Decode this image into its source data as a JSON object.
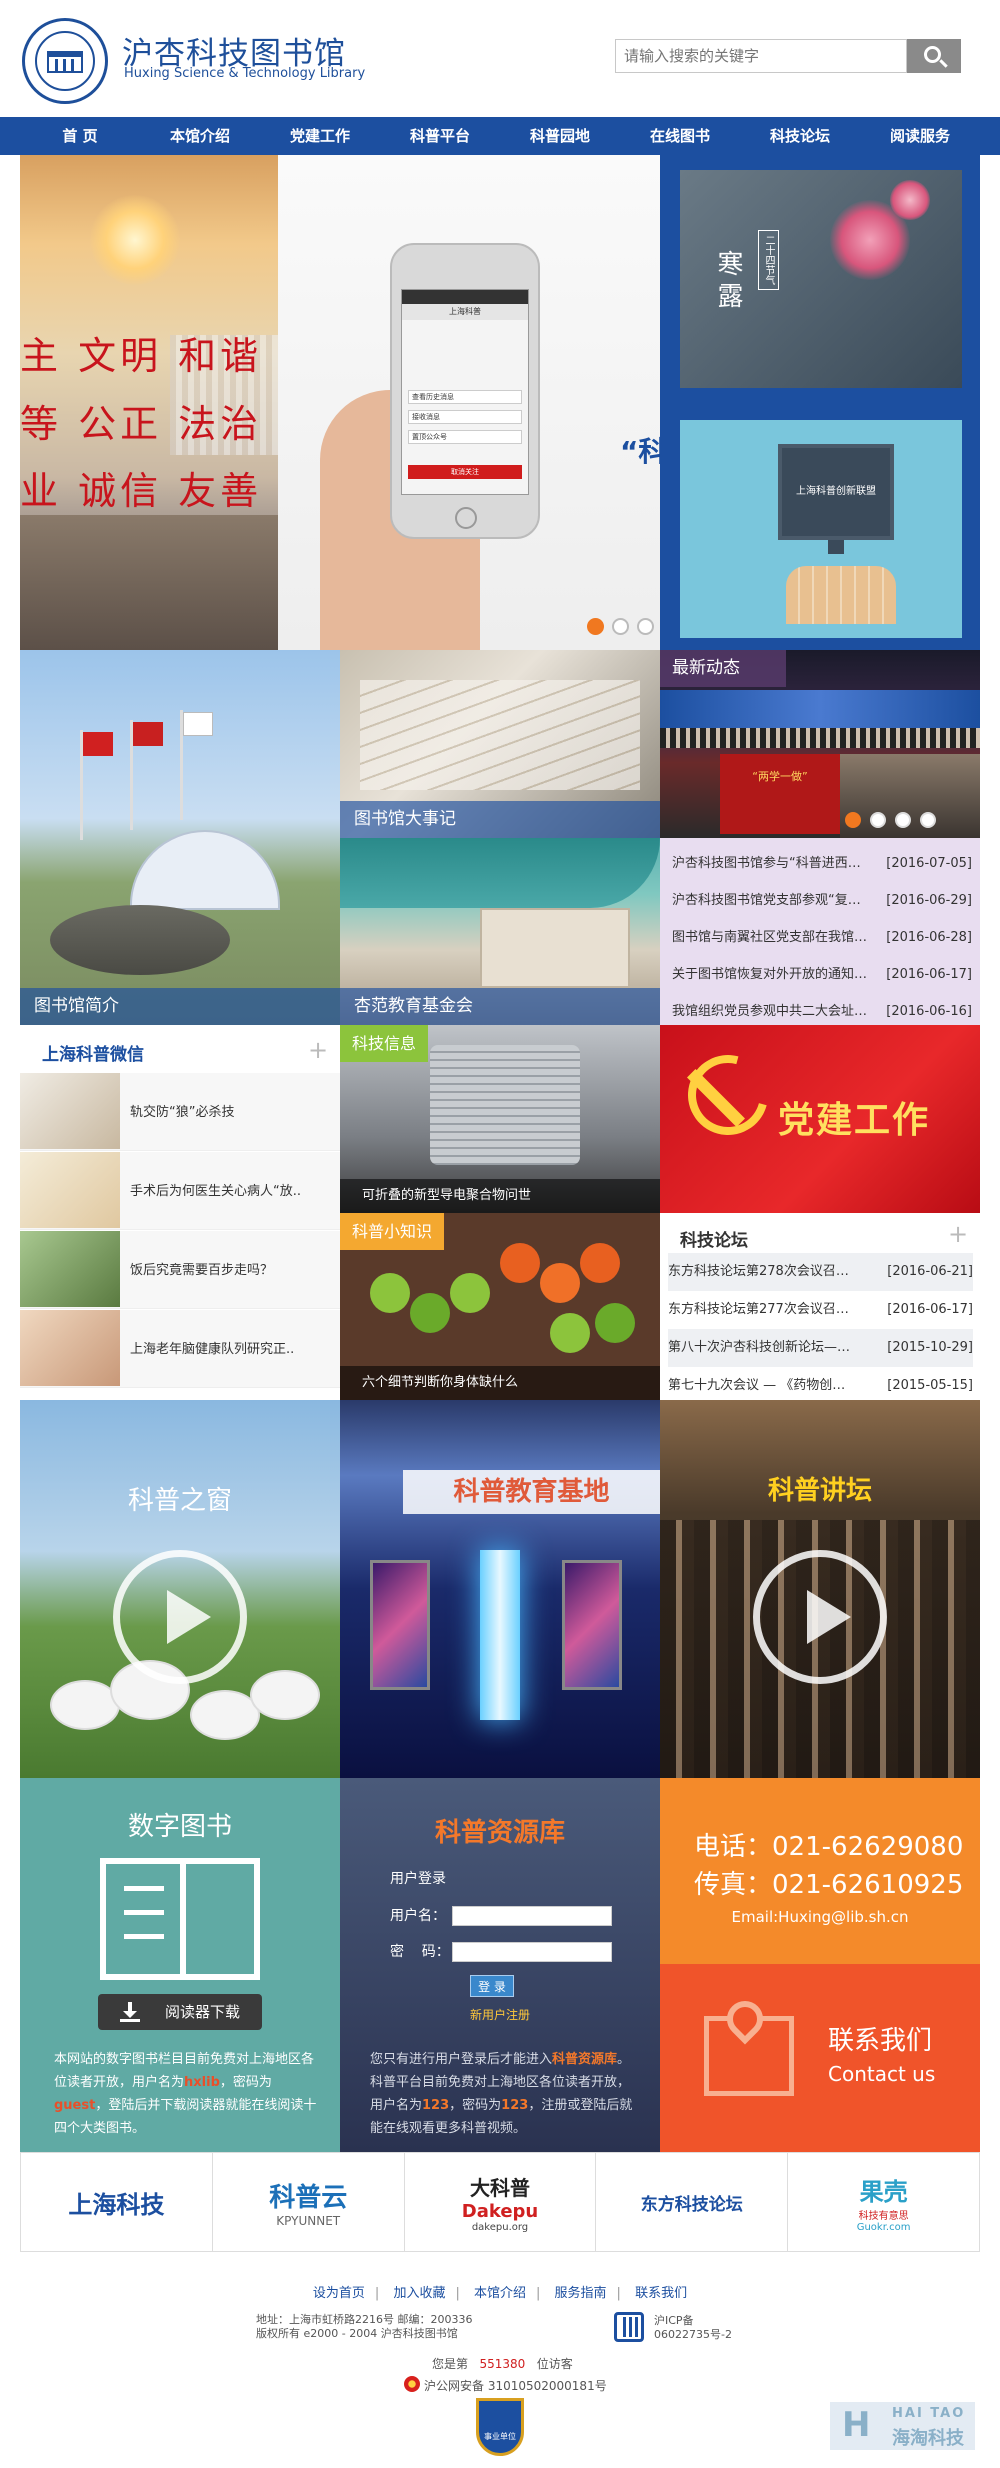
{
  "header": {
    "logo_cn": "沪杏科技图书馆",
    "logo_en": "Huxing Science & Technology Library",
    "search_placeholder": "请输入搜索的关键字"
  },
  "nav": {
    "items": [
      "首 页",
      "本馆介绍",
      "党建工作",
      "科普平台",
      "科普园地",
      "在线图书",
      "科技论坛",
      "阅读服务"
    ]
  },
  "hero": {
    "slogan": [
      "主 文明 和谐",
      "等 公正 法治",
      "业 诚信 友善"
    ],
    "quote": "“科",
    "phone": {
      "header": "上海科普",
      "rows": [
        "查看历史消息",
        "接收消息",
        "置顶公众号",
        "取消关注"
      ]
    },
    "dots": 3,
    "active_dot": 1
  },
  "slides": {
    "slide1_title": "寒露",
    "slide1_sub": "二十四节气",
    "slide2_screen": "上海科普创新联盟"
  },
  "tiles": {
    "intro": "图书馆简介",
    "events": "图书馆大事记",
    "fund": "杏范教育基金会"
  },
  "news": {
    "tag": "最新动态",
    "photo_banner": "“两学一做”",
    "dots": 4,
    "active_dot": 1,
    "items": [
      {
        "title": "沪杏科技图书馆参与“科普进西…",
        "date": "[2016-07-05]"
      },
      {
        "title": "沪杏科技图书馆党支部参观“复…",
        "date": "[2016-06-29]"
      },
      {
        "title": "图书馆与南翼社区党支部在我馆…",
        "date": "[2016-06-28]"
      },
      {
        "title": "关于图书馆恢复对外开放的通知…",
        "date": "[2016-06-17]"
      },
      {
        "title": "我馆组织党员参观中共二大会址…",
        "date": "[2016-06-16]"
      }
    ]
  },
  "wechat": {
    "title": "上海科普微信",
    "plus": "+",
    "items": [
      "轨交防“狼”必杀技",
      "手术后为何医生关心病人“放..",
      "饭后究竟需要百步走吗？",
      "上海老年脑健康队列研究正.."
    ]
  },
  "tech_info": {
    "tag": "科技信息",
    "caption": "可折叠的新型导电聚合物问世"
  },
  "sci_tips": {
    "tag": "科普小知识",
    "caption": "六个细节判断你身体缺什么"
  },
  "party": {
    "title": "党建工作"
  },
  "forum": {
    "title": "科技论坛",
    "plus": "+",
    "items": [
      {
        "title": "东方科技论坛第278次会议召…",
        "date": "[2016-06-21]"
      },
      {
        "title": "东方科技论坛第277次会议召…",
        "date": "[2016-06-17]"
      },
      {
        "title": "第八十次沪杏科技创新论坛—…",
        "date": "[2015-10-29]"
      },
      {
        "title": "第七十九次会议 — 《药物创…",
        "date": "[2015-05-15]"
      }
    ]
  },
  "features": {
    "window": "科普之窗",
    "edu": "科普教育基地",
    "lecture": "科普讲坛"
  },
  "digital": {
    "title": "数字图书",
    "download": "阅读器下载",
    "desc_1": "本网站的数字图书栏目目前免费对上海地区各位读者开放，用户名为",
    "user": "hxlib",
    "desc_2": "，密码为",
    "pass": "guest",
    "desc_3": "，登陆后并下载阅读器就能在线阅读十四个大类图书。"
  },
  "resource": {
    "title": "科普资源库",
    "login_label": "用户登录",
    "user_label": "用户名：",
    "pass_label": "密    码：",
    "login_btn": "登 录",
    "register": "新用户注册",
    "desc_1": "您只有进行用户登录后才能进入",
    "link": "科普资源库",
    "desc_2": "。科普平台目前免费对上海地区各位读者开放，用户名为",
    "user": "123",
    "desc_3": "，密码为",
    "pass": "123",
    "desc_4": "，注册或登陆后就能在线观看更多科普视频。"
  },
  "contact": {
    "phone_label": "电话：",
    "phone": "021-62629080",
    "fax_label": "传真：",
    "fax": "021-62610925",
    "email": "Email:Huxing@lib.sh.cn",
    "title_cn": "联系我们",
    "title_en": "Contact us"
  },
  "partners": [
    {
      "name": "上海科技",
      "sub": ""
    },
    {
      "name": "科普云",
      "sub": "KPYUNNET"
    },
    {
      "name": "大科普",
      "sub": "Dakepu",
      "sub2": "dakepu.org"
    },
    {
      "name": "东方科技论坛",
      "sub": ""
    },
    {
      "name": "果壳",
      "sub": "科技有意思",
      "sub2": "Guokr.com"
    }
  ],
  "footer": {
    "links": [
      "设为首页",
      "加入收藏",
      "本馆介绍",
      "服务指南",
      "联系我们"
    ],
    "address": "地址：上海市虹桥路2216号    邮编：200336",
    "copyright": "版权所有   e2000 - 2004  沪杏科技图书馆",
    "icp": "沪ICP备",
    "icp_no": "06022735号-2",
    "visits_label": "您是第",
    "visits": "551380",
    "visits_suffix": "位访客",
    "police": "沪公网安备 31010502000181号",
    "badge": "事业单位"
  },
  "watermark": {
    "en": "HAI TAO",
    "cn": "海淘科技"
  },
  "colors": {
    "nav": "#1c4fa0",
    "accent": "#f07820",
    "party_red": "#c8101a",
    "teal": "#60aaa4",
    "orange": "#f48a2a"
  }
}
